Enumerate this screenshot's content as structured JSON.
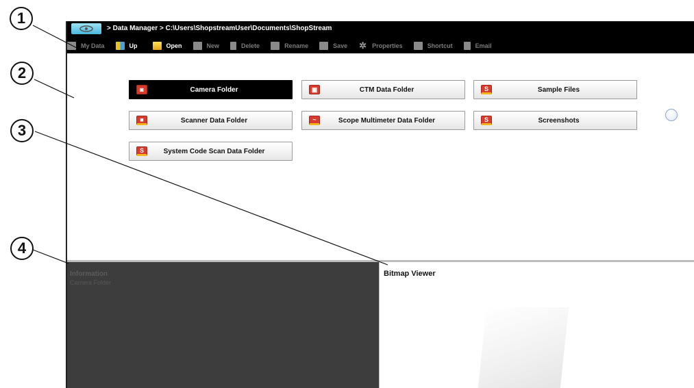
{
  "callouts": [
    "1",
    "2",
    "3",
    "4"
  ],
  "titlebar": {
    "home_icon": "home-tab-icon",
    "path": "> Data Manager   > C:\\Users\\ShopstreamUser\\Documents\\ShopStream"
  },
  "toolbar": {
    "items": [
      {
        "label": "My Data",
        "icon": "my-data-icon",
        "enabled": false
      },
      {
        "label": "Up",
        "icon": "up-folder-icon",
        "enabled": true
      },
      {
        "label": "Open",
        "icon": "open-folder-icon",
        "enabled": true
      },
      {
        "label": "New",
        "icon": "new-folder-icon",
        "enabled": false
      },
      {
        "label": "Delete",
        "icon": "trash-icon",
        "enabled": false
      },
      {
        "label": "Rename",
        "icon": "rename-icon",
        "enabled": false
      },
      {
        "label": "Save",
        "icon": "save-icon",
        "enabled": false
      },
      {
        "label": "Properties",
        "icon": "gears-icon",
        "enabled": false
      },
      {
        "label": "Shortcut",
        "icon": "shortcut-icon",
        "enabled": false
      },
      {
        "label": "Email",
        "icon": "email-icon",
        "enabled": false
      }
    ]
  },
  "folders": [
    {
      "label": "Camera Folder",
      "icon": "camera-folder-icon",
      "selected": true
    },
    {
      "label": "CTM Data Folder",
      "icon": "ctm-folder-icon",
      "selected": false
    },
    {
      "label": "Sample Files",
      "icon": "snapon-folder-icon",
      "selected": false
    },
    {
      "label": "Scanner Data Folder",
      "icon": "scanner-folder-icon",
      "selected": false
    },
    {
      "label": "Scope Multimeter Data Folder",
      "icon": "scope-folder-icon",
      "selected": false
    },
    {
      "label": "Screenshots",
      "icon": "snapon-folder-icon",
      "selected": false
    },
    {
      "label": "System Code Scan Data Folder",
      "icon": "snapon-folder-icon",
      "selected": false
    }
  ],
  "info_panel": {
    "title": "Information",
    "subtitle": "Camera Folder"
  },
  "bitmap_panel": {
    "title": "Bitmap Viewer"
  },
  "colors": {
    "titlebar": "#000000",
    "selected_folder": "#000000",
    "info_panel": "#3d3d3d",
    "accent_home": "#4ab7dd"
  }
}
